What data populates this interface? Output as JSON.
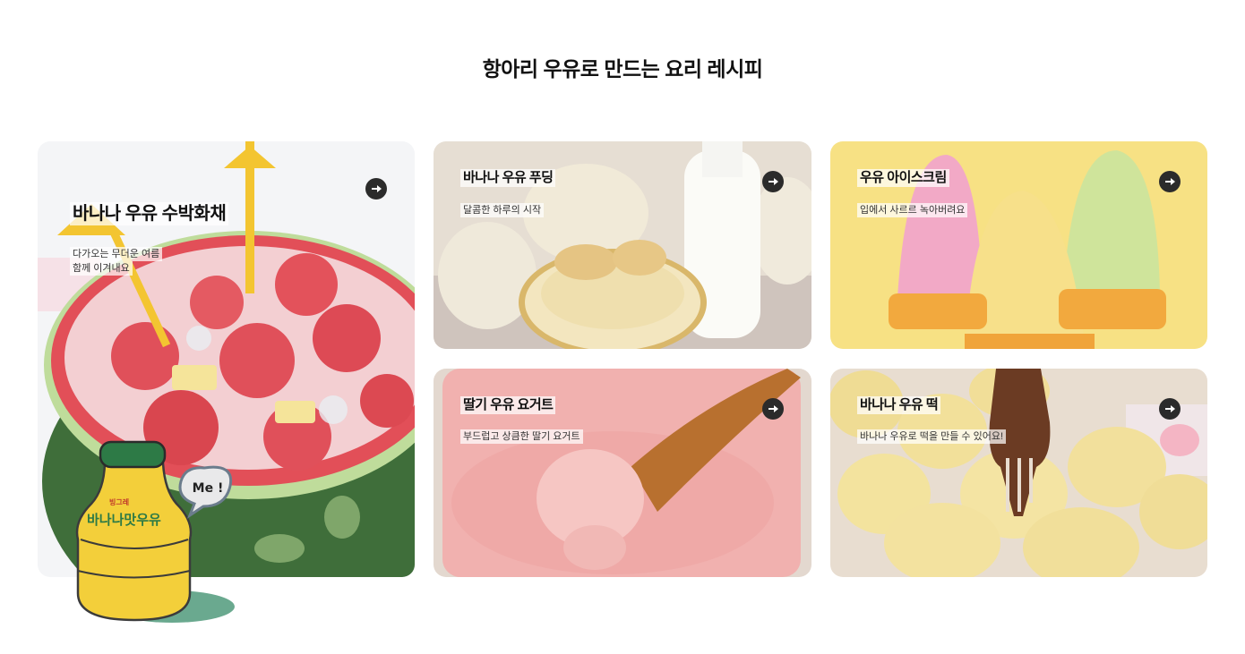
{
  "section": {
    "title": "항아리 우유로 만드는 요리 레시피"
  },
  "recipes": [
    {
      "title": "바나나 우유 수박화채",
      "desc_line1": "다가오는 무더운 여름",
      "desc_line2": "함께 이겨내요",
      "arrow_icon": "arrow-right-circle-icon"
    },
    {
      "title": "바나나 우유 푸딩",
      "desc_line1": "달콤한 하루의 시작",
      "arrow_icon": "arrow-right-circle-icon"
    },
    {
      "title": "우유 아이스크림",
      "desc_line1": "입에서 사르르 녹아버려요",
      "arrow_icon": "arrow-right-circle-icon"
    },
    {
      "title": "딸기 우유 요거트",
      "desc_line1": "부드럽고 상큼한 딸기 요거트",
      "arrow_icon": "arrow-right-circle-icon"
    },
    {
      "title": "바나나 우유 떡",
      "desc_line1": "바나나 우유로 떡을 만들 수 있어요!",
      "arrow_icon": "arrow-right-circle-icon"
    }
  ],
  "mascot": {
    "bottle_brand": "빙그레",
    "bottle_label": "바나나맛우유",
    "speech": "Me !"
  },
  "colors": {
    "watermelon_red": "#e8505b",
    "banana_yellow": "#f3cf3a",
    "strawberry_pink": "#f2b3b1",
    "icecream_bg": "#f7e184",
    "arrow_dark": "#2b2b2b"
  }
}
